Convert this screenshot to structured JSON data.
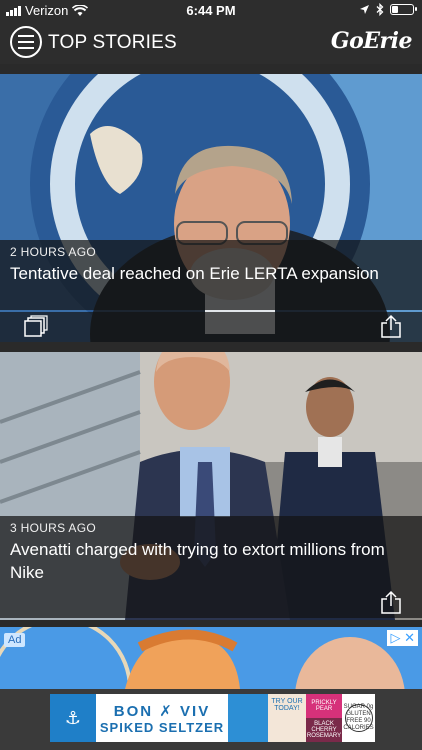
{
  "status_bar": {
    "carrier": "Verizon",
    "time": "6:44 PM"
  },
  "header": {
    "title": "TOP STORIES",
    "logo": "GoErie"
  },
  "stories": [
    {
      "time": "2 HOURS AGO",
      "headline": "Tentative deal reached on Erie LERTA expansion",
      "has_gallery": true
    },
    {
      "time": "3 HOURS AGO",
      "headline": "Avenatti charged with trying to extort millions from Nike",
      "has_gallery": false
    }
  ],
  "ad": {
    "label": "Ad",
    "close": "▷ ✕",
    "banner": {
      "brand_line1": "BON ✗ VIV",
      "brand_line2": "SPIKED SELTZER",
      "try_text": "TRY OUR TODAY!",
      "flavor1": "PRICKLY PEAR",
      "flavor2": "BLACK CHERRY ROSEMARY",
      "badge": "SUGAR 0g GLUTEN FREE 90 CALORIES"
    }
  },
  "colors": {
    "header_bg": "#2d2d2d",
    "page_bg": "#2a2a2a",
    "ad_blue": "#1f7fc8"
  }
}
